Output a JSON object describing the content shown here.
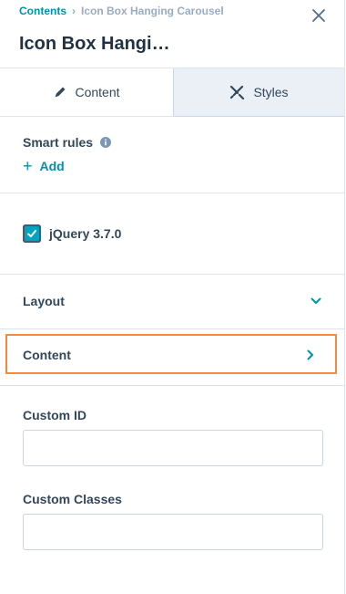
{
  "breadcrumb": {
    "root": "Contents",
    "separator": "›",
    "current": "Icon Box Hanging Carousel"
  },
  "header": {
    "title": "Icon Box Hangi…"
  },
  "tabs": [
    {
      "label": "Content",
      "icon": "pencil-icon",
      "active": true
    },
    {
      "label": "Styles",
      "icon": "brush-icon",
      "active": false
    }
  ],
  "smart_rules": {
    "label": "Smart rules",
    "add_label": "Add"
  },
  "jquery": {
    "label": "jQuery 3.7.0",
    "checked": true
  },
  "accordions": [
    {
      "label": "Layout",
      "state": "expanded"
    },
    {
      "label": "Content",
      "state": "collapsed"
    }
  ],
  "fields": {
    "custom_id": {
      "label": "Custom ID",
      "value": ""
    },
    "custom_classes": {
      "label": "Custom Classes",
      "value": ""
    }
  },
  "colors": {
    "accent": "#0091ae",
    "highlight_border": "#f5893d",
    "checkbox": "#00a4bd",
    "text": "#33475b"
  }
}
